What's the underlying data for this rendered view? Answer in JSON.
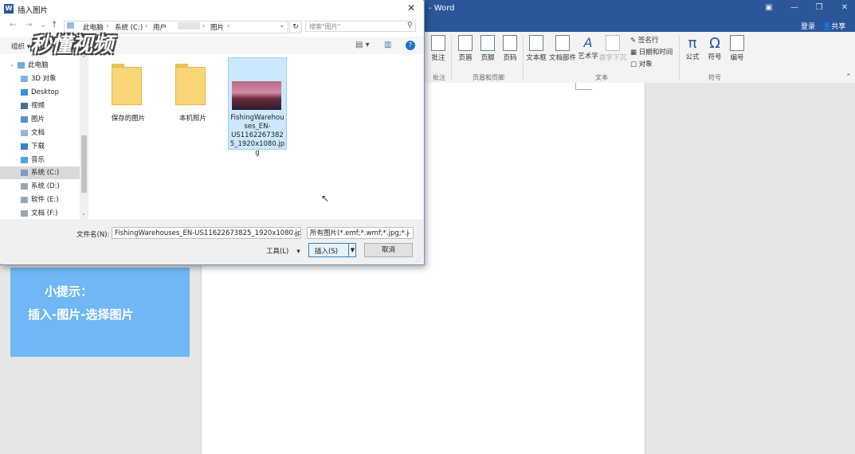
{
  "word": {
    "title": "- Word",
    "login": "登录",
    "share": "共享",
    "ribbon": {
      "buttons": [
        "批注",
        "页眉",
        "页脚",
        "页码",
        "文本框",
        "文档部件",
        "艺术字",
        "首字下沉",
        "公式",
        "符号",
        "编号"
      ],
      "small": [
        "签名行",
        "日期和时间",
        "对象"
      ],
      "groups": [
        "批注",
        "页眉和页脚",
        "文本",
        "符号"
      ]
    }
  },
  "tip": {
    "title": "小提示：",
    "body": "插入-图片-选择图片"
  },
  "logo": "秒懂视频",
  "dialog": {
    "title": "插入图片",
    "breadcrumbs": [
      "此电脑",
      "系统 (C:)",
      "用户",
      "图片"
    ],
    "search_placeholder": "搜索\"图片\"",
    "organize": "组织 ▾",
    "nav_items": [
      {
        "label": "此电脑",
        "icon": "pc-icon"
      },
      {
        "label": "3D 对象",
        "icon": "3d-icon"
      },
      {
        "label": "Desktop",
        "icon": "desktop-icon"
      },
      {
        "label": "视频",
        "icon": "video-icon"
      },
      {
        "label": "图片",
        "icon": "picture-icon"
      },
      {
        "label": "文档",
        "icon": "document-icon"
      },
      {
        "label": "下载",
        "icon": "download-icon"
      },
      {
        "label": "音乐",
        "icon": "music-icon"
      },
      {
        "label": "系统 (C:)",
        "icon": "drive-icon"
      },
      {
        "label": "系统 (D:)",
        "icon": "drive-icon"
      },
      {
        "label": "软件 (E:)",
        "icon": "drive-icon"
      },
      {
        "label": "文档 (F:)",
        "icon": "drive-icon"
      }
    ],
    "folders": [
      "保存的图片",
      "本机照片"
    ],
    "file_name": "FishingWarehouses_EN-US11622673825_1920x1080.jpg",
    "file_name_label": "文件名(N):",
    "file_name_value": "FishingWarehouses_EN-US11622673825_1920x1080.jp",
    "filter": "所有图片(*.emf;*.wmf;*.jpg;*.j",
    "tools": "工具(L)",
    "insert": "插入(S)",
    "cancel": "取消"
  }
}
